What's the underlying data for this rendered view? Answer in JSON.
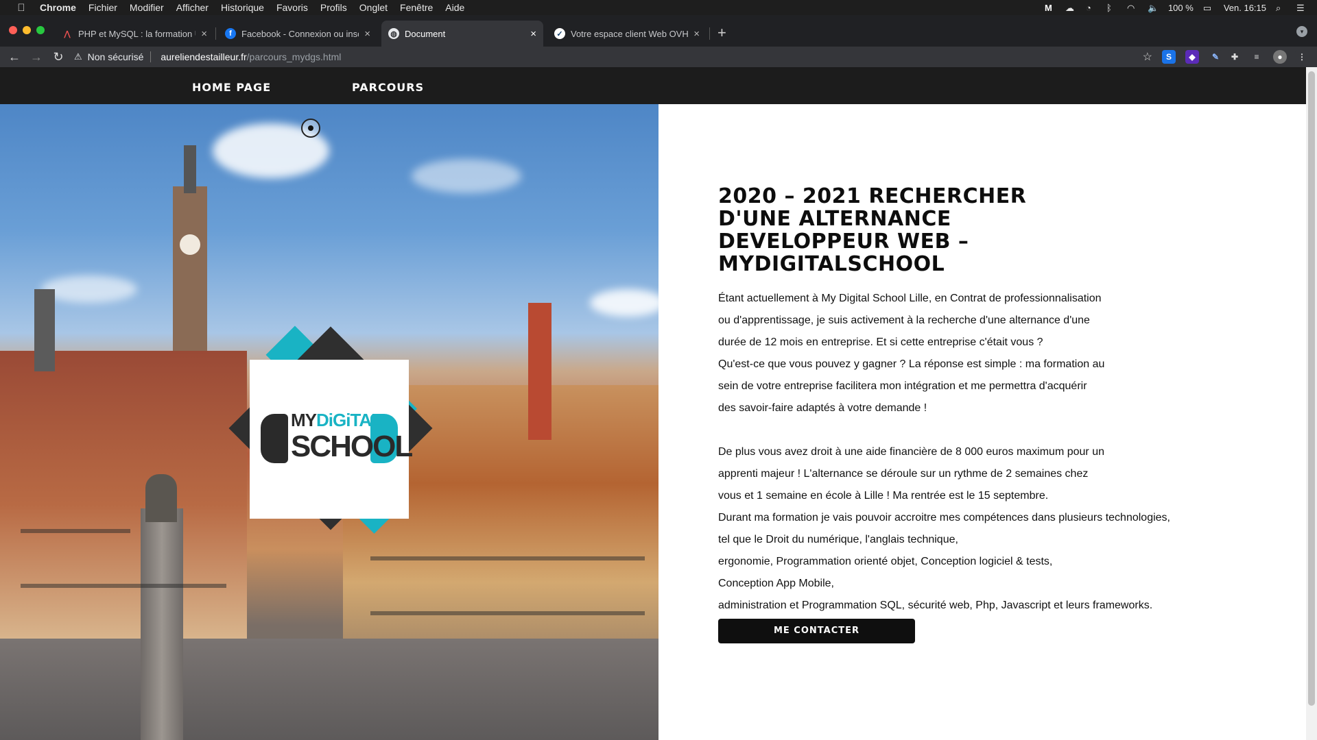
{
  "menubar": {
    "app": "Chrome",
    "items": [
      "Fichier",
      "Modifier",
      "Afficher",
      "Historique",
      "Favoris",
      "Profils",
      "Onglet",
      "Fenêtre",
      "Aide"
    ],
    "battery": "100 %",
    "clock": "Ven. 16:15"
  },
  "tabs": [
    {
      "title": "PHP et MySQL : la formation U",
      "favicon": "udemy-icon"
    },
    {
      "title": "Facebook - Connexion ou insc",
      "favicon": "facebook-icon"
    },
    {
      "title": "Document",
      "favicon": "globe-icon"
    },
    {
      "title": "Votre espace client Web OVHc",
      "favicon": "ovh-icon"
    }
  ],
  "address": {
    "security": "Non sécurisé",
    "host": "aureliendestailleur.fr",
    "path": "/parcours_mydgs.html"
  },
  "nav": {
    "home": "HOME PAGE",
    "parcours": "PARCOURS"
  },
  "logo": {
    "my": "MY",
    "digital": "DiGiTAL",
    "school": "SCHOOL"
  },
  "content": {
    "heading": "2020 – 2021 RECHERCHER D'UNE ALTERNANCE DEVELOPPEUR WEB – MYDIGITALSCHOOL",
    "lines": [
      "Étant actuellement à My Digital School Lille, en Contrat de professionnalisation",
      "ou d'apprentissage, je suis activement à la recherche d'une alternance d'une",
      "durée de 12 mois en entreprise. Et si cette entreprise c'était vous ?",
      "Qu'est-ce que vous pouvez y gagner ? La réponse est simple : ma formation au",
      "sein de votre entreprise facilitera mon intégration et me permettra d'acquérir",
      "des savoir-faire adaptés à votre demande !",
      "",
      "De plus vous avez droit à une aide financière de 8 000 euros maximum pour un",
      "apprenti majeur ! L'alternance se déroule sur un rythme de 2 semaines chez",
      "vous et 1 semaine en école à Lille ! Ma rentrée est le 15 septembre.",
      "Durant ma formation je vais pouvoir accroitre mes compétences dans plusieurs technologies,",
      "tel que le Droit du numérique, l'anglais technique,",
      "ergonomie, Programmation orienté objet, Conception logiciel & tests,",
      "Conception App Mobile,",
      "administration et Programmation SQL, sécurité web, Php, Javascript et leurs frameworks."
    ],
    "cta": "ME CONTACTER"
  },
  "colors": {
    "accent_teal": "#19b3c4",
    "nav_bg": "#1c1c1c",
    "cta_bg": "#0f0f0f"
  }
}
